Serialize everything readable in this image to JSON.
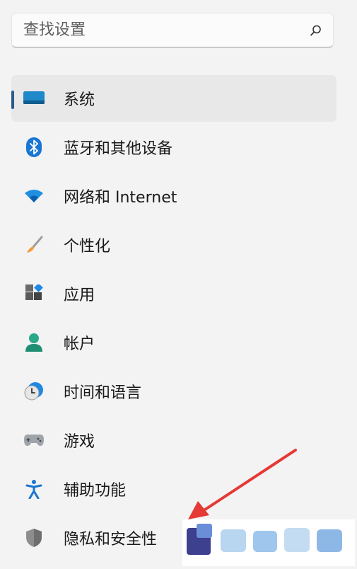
{
  "search": {
    "placeholder": "查找设置",
    "icon": "search-icon"
  },
  "nav": {
    "items": [
      {
        "label": "系统",
        "icon": "system-monitor-icon",
        "selected": true
      },
      {
        "label": "蓝牙和其他设备",
        "icon": "bluetooth-icon"
      },
      {
        "label": "网络和 Internet",
        "icon": "wifi-icon"
      },
      {
        "label": "个性化",
        "icon": "paintbrush-icon"
      },
      {
        "label": "应用",
        "icon": "apps-icon"
      },
      {
        "label": "帐户",
        "icon": "account-icon"
      },
      {
        "label": "时间和语言",
        "icon": "time-language-icon"
      },
      {
        "label": "游戏",
        "icon": "gamepad-icon"
      },
      {
        "label": "辅助功能",
        "icon": "accessibility-icon"
      },
      {
        "label": "隐私和安全性",
        "icon": "shield-icon"
      }
    ]
  },
  "colors": {
    "background": "#f3f3f3",
    "selected_item": "#e8e8e8",
    "selection_indicator": "#2b5b8a",
    "annotation_arrow": "#e53935"
  }
}
